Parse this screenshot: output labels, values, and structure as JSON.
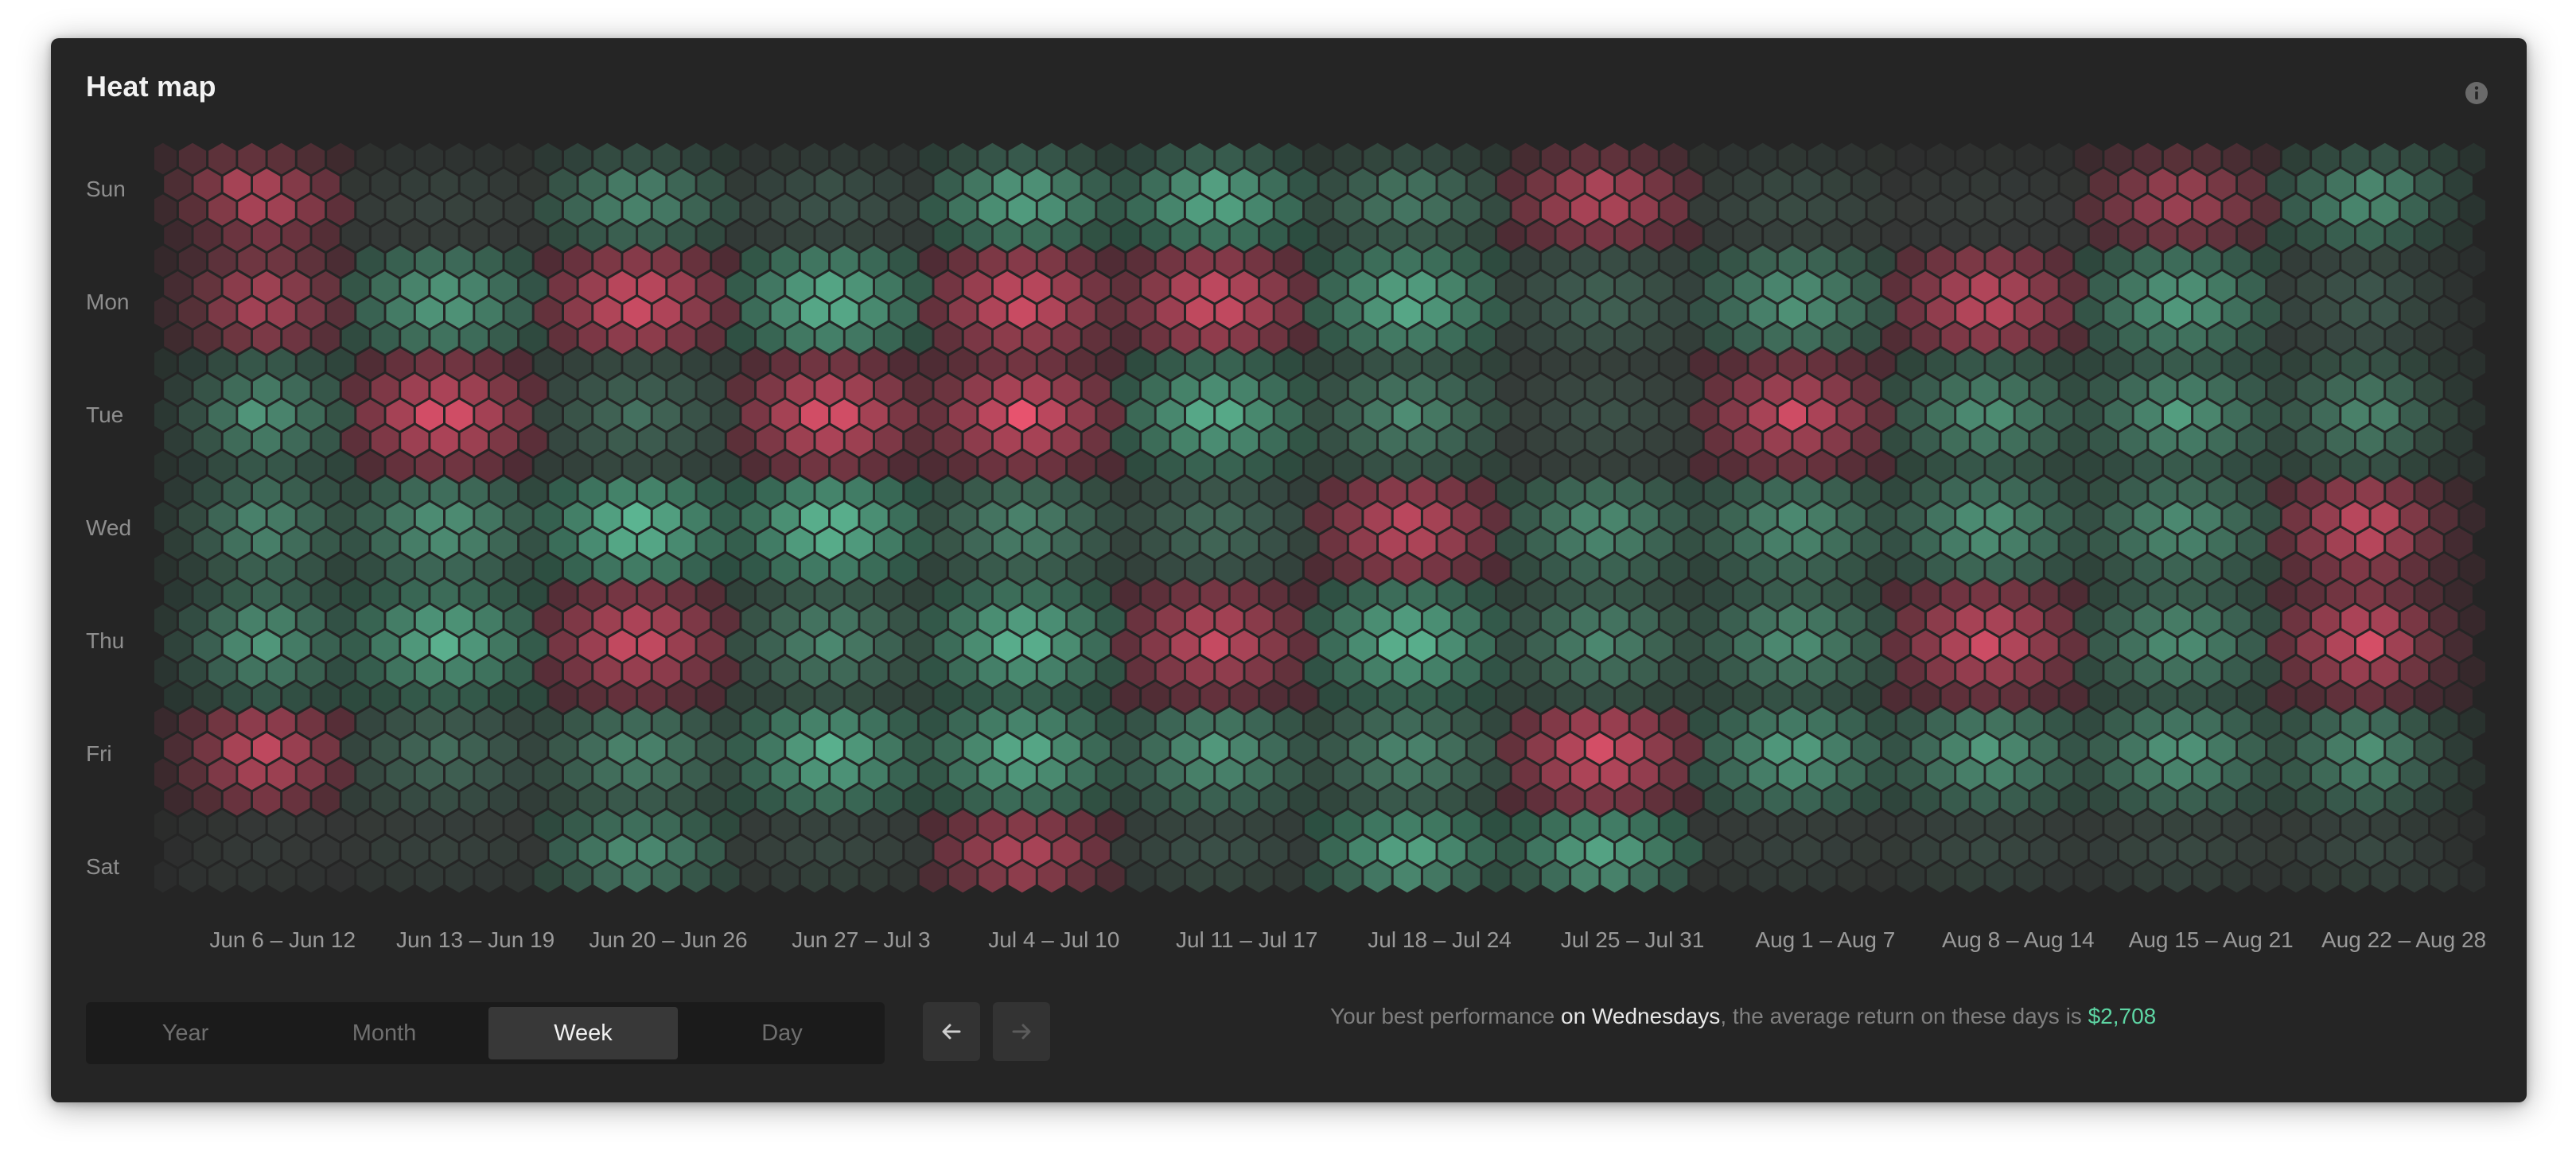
{
  "title": "Heat map",
  "icons": {
    "info": "info-icon",
    "prev": "arrow-left-icon",
    "next": "arrow-right-icon"
  },
  "colors": {
    "positive": "#6fe0b3",
    "negative": "#e8536e",
    "neutral": "#4a4a4a",
    "background": "#252525"
  },
  "periods": [
    {
      "label": "Year",
      "active": false
    },
    {
      "label": "Month",
      "active": false
    },
    {
      "label": "Week",
      "active": true
    },
    {
      "label": "Day",
      "active": false
    }
  ],
  "summary": {
    "prefix": "Your best performance",
    "emphasis": "on Wednesdays",
    "middle": ", the average return on these days is",
    "value": "$2,708"
  },
  "chart_data": {
    "type": "heatmap",
    "title": "Heat map",
    "y_categories": [
      "Sun",
      "Mon",
      "Tue",
      "Wed",
      "Thu",
      "Fri",
      "Sat"
    ],
    "x_categories": [
      "Jun 6 – Jun 12",
      "Jun 13 – Jun 19",
      "Jun 20 – Jun 26",
      "Jun 27 – Jul 3",
      "Jul 4 – Jul 10",
      "Jul 11 – Jul 17",
      "Jul 18 – Jul 24",
      "Jul 25 – Jul 31",
      "Aug 1 – Aug 7",
      "Aug 8 – Aug 14",
      "Aug 15 – Aug 21",
      "Aug 22 – Aug 28"
    ],
    "scale": "diverging (-1 = loss, red; +1 = gain, green)",
    "values": [
      [
        -0.9,
        0.1,
        0.55,
        0.2,
        0.75,
        0.8,
        0.45,
        -0.85,
        0.15,
        0.05,
        -0.7,
        0.6
      ],
      [
        -0.7,
        0.6,
        -0.9,
        0.75,
        -0.9,
        -0.9,
        0.7,
        0.25,
        0.55,
        -0.8,
        0.6,
        0.2
      ],
      [
        0.55,
        -0.95,
        0.3,
        -0.95,
        -0.95,
        0.7,
        0.45,
        0.15,
        -0.8,
        0.5,
        0.55,
        0.45
      ],
      [
        0.5,
        0.55,
        0.8,
        0.8,
        0.45,
        0.3,
        -0.8,
        0.5,
        0.5,
        0.55,
        0.5,
        -0.85
      ],
      [
        0.6,
        0.7,
        -0.85,
        0.45,
        0.75,
        -0.8,
        0.75,
        0.45,
        0.5,
        -0.85,
        0.5,
        -0.9
      ],
      [
        -0.85,
        0.3,
        0.45,
        0.7,
        0.7,
        0.55,
        0.45,
        -0.9,
        0.6,
        0.55,
        0.55,
        0.5
      ],
      [
        0.05,
        0.1,
        0.65,
        0.15,
        -0.9,
        0.2,
        0.85,
        0.85,
        0.1,
        0.15,
        0.15,
        0.15
      ]
    ]
  }
}
